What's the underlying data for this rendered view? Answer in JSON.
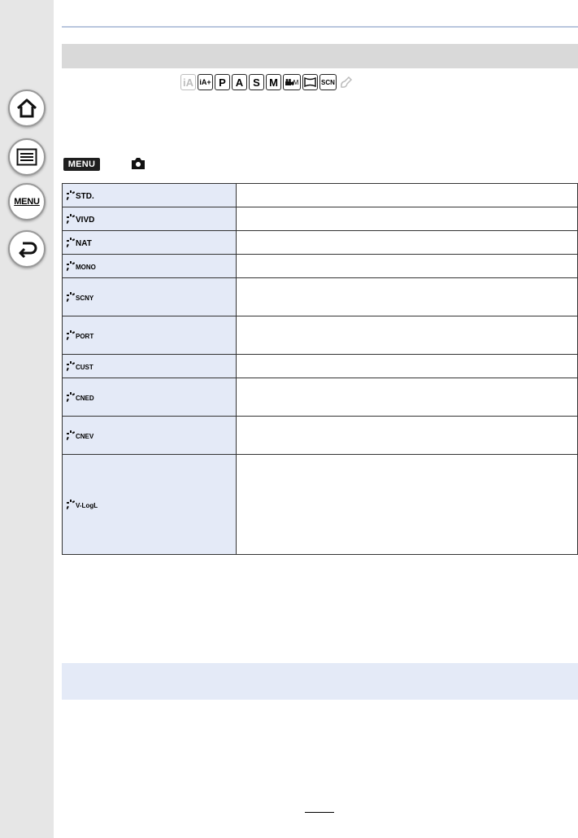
{
  "sidebar": {
    "home_icon": "home-icon",
    "contents_icon": "list-icon",
    "menu_label": "MENU",
    "back_icon": "return-icon"
  },
  "modes": [
    {
      "label": "iA",
      "state": "disabled"
    },
    {
      "label": "iA+",
      "state": "enabled"
    },
    {
      "label": "P",
      "state": "enabled"
    },
    {
      "label": "A",
      "state": "enabled"
    },
    {
      "label": "S",
      "state": "enabled"
    },
    {
      "label": "M",
      "state": "enabled"
    },
    {
      "label": "M",
      "state": "enabled",
      "kind": "movie"
    },
    {
      "label": "",
      "state": "enabled",
      "kind": "panorama"
    },
    {
      "label": "SCN",
      "state": "enabled"
    },
    {
      "label": "",
      "state": "disabled",
      "kind": "creative"
    }
  ],
  "menu_badge": "MENU",
  "photo_styles": [
    {
      "code": "STD.",
      "rows": 1
    },
    {
      "code": "VIVD",
      "rows": 1
    },
    {
      "code": "NAT",
      "rows": 1
    },
    {
      "code": "MONO",
      "rows": 1,
      "small": true
    },
    {
      "code": "SCNY",
      "rows": 2,
      "small": true
    },
    {
      "code": "PORT",
      "rows": 2,
      "small": true
    },
    {
      "code": "CUST",
      "rows": 1,
      "small": true
    },
    {
      "code": "CNED",
      "rows": 2,
      "small": true
    },
    {
      "code": "CNEV",
      "rows": 2,
      "small": true
    },
    {
      "code": "V-LogL",
      "rows": 5,
      "small": true
    }
  ],
  "colors": {
    "sidebar": "#e6e6e6",
    "header_bar": "#d9d9d9",
    "table_label_bg": "#e4eaf7",
    "note_bg": "#e4eaf7"
  }
}
